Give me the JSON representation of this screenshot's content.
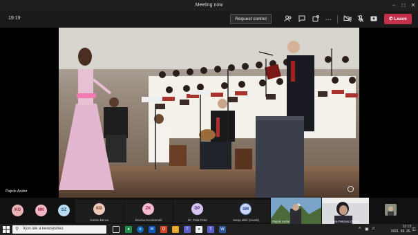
{
  "window": {
    "title": "Meeting now"
  },
  "toolbar": {
    "timer": "19:19",
    "request_control": "Request control",
    "leave": "Leave"
  },
  "main_video": {
    "speaker": "Pajrok Andor"
  },
  "participants": [
    {
      "initials": "KG",
      "color": "#e8b4b8",
      "text_color": "#8a2a3a"
    },
    {
      "initials": "MK",
      "color": "#f2b8c6",
      "text_color": "#a0203a"
    },
    {
      "initials": "SZ",
      "color": "#b8dcef",
      "text_color": "#1c5a88"
    },
    {
      "initials": "KB",
      "color": "#ecc9b8",
      "text_color": "#7a3a20",
      "name": "Kürtös Bence"
    },
    {
      "initials": "ZK",
      "color": "#f3bcd0",
      "text_color": "#a0204a",
      "name": "Zsuzsa Kecskeméti"
    },
    {
      "initials": "DP",
      "color": "#d7c5ef",
      "text_color": "#4a2e8a",
      "name": "Dr. Pölä Péter"
    },
    {
      "initials": "SM",
      "color": "#c9d8f5",
      "text_color": "#1e3e88",
      "name": "Sanja Milić (Guest)"
    }
  ],
  "video_tiles": [
    {
      "name": "Pajrok Andor"
    },
    {
      "name": "dr. Olivera Petrovic (Guest)"
    }
  ],
  "taskbar": {
    "search_placeholder": "Írjon ide a kereséshez",
    "time": "11:13",
    "date": "2021. 03. 25."
  }
}
